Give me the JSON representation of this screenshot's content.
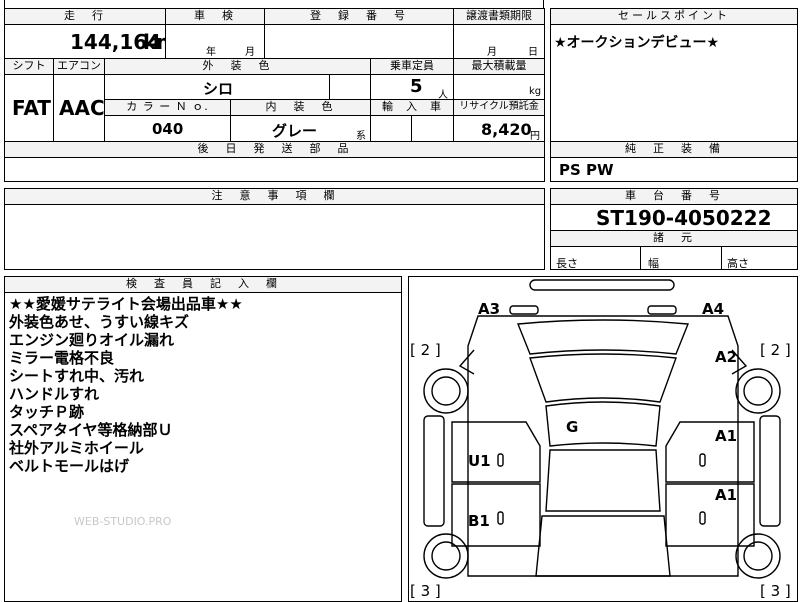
{
  "header": {
    "mileage_label": "走　行",
    "inspection_label": "車　検",
    "registration_label": "登　録　番　号",
    "transfer_label": "譲渡書類期限",
    "sales_point_label": "セールスポイント"
  },
  "mileage": {
    "value": "144,164",
    "unit": "km"
  },
  "inspection": {
    "year_unit": "年",
    "month_unit": "月"
  },
  "transfer": {
    "month_unit": "月",
    "day_unit": "日"
  },
  "sales_point": {
    "text": "★オークションデビュー★"
  },
  "specs": {
    "shift_label": "シフト",
    "ac_label": "エアコン",
    "exterior_label": "外　装　色",
    "capacity_label": "乗車定員",
    "max_load_label": "最大積載量",
    "shift_value": "FAT",
    "ac_value": "AAC",
    "exterior_value": "シロ",
    "capacity_value": "5",
    "capacity_unit": "人",
    "max_load_unit": "kg",
    "color_no_label": "カ ラ ー Ｎ ｏ.",
    "interior_label": "内　装　色",
    "import_label": "輸　入　車",
    "recycle_label": "リサイクル預託金",
    "color_no_value": "040",
    "interior_value": "グレー",
    "interior_unit": "系",
    "recycle_value": "8,420",
    "recycle_unit": "円"
  },
  "later_parts": {
    "label": "後　日　発　送　部　品"
  },
  "genuine": {
    "label": "純　正　装　備",
    "value": "PS PW"
  },
  "caution": {
    "label": "注　意　事　項　欄"
  },
  "chassis": {
    "label": "車　台　番　号",
    "value": "ST190-4050222"
  },
  "dimensions": {
    "label": "諸　元",
    "length_label": "長さ",
    "width_label": "幅",
    "height_label": "高さ"
  },
  "inspector": {
    "label": "検　査　員　記　入　欄",
    "notes": [
      "★★愛媛サテライト会場出品車★★",
      "外装色あせ、うすい線キズ",
      "エンジン廻りオイル漏れ",
      "ミラー電格不良",
      "シートすれ中、汚れ",
      "ハンドルすれ",
      "タッチＰ跡",
      "スペアタイヤ等格納部Ｕ",
      "社外アルミホイール",
      "ベルトモールはげ"
    ],
    "watermark": "WEB-STUDIO.PRO"
  },
  "diagram": {
    "a3": "A3",
    "a4": "A4",
    "a2": "A2",
    "a1_top": "A1",
    "a1_bottom": "A1",
    "g": "G",
    "u1": "U1",
    "b1": "B1",
    "bracket_left_top": "[ 2 ]",
    "bracket_right_top": "[ 2 ]",
    "bracket_left_bottom": "[ 3 ]",
    "bracket_right_bottom": "[ 3 ]"
  }
}
